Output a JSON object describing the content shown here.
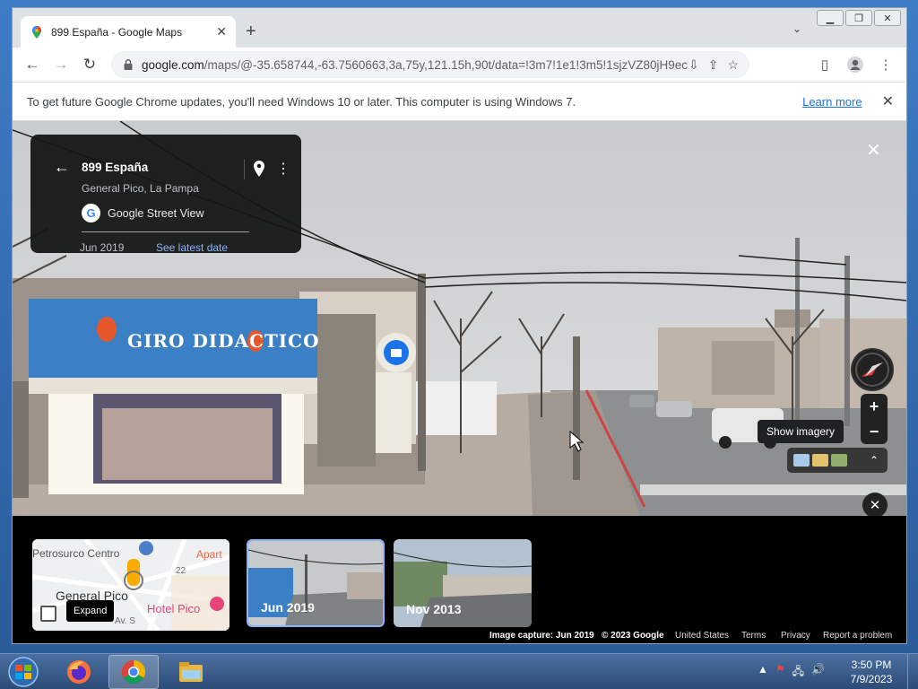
{
  "browser": {
    "tab_title": "899 España - Google Maps",
    "url_host": "google.com",
    "url_rest": "/maps/@-35.658744,-63.7560663,3a,75y,121.15h,90t/data=!3m7!1e1!3m5!1sjzVZ80jH9ecl..."
  },
  "infobar": {
    "message": "To get future Google Chrome updates, you'll need Windows 10 or later. This computer is using Windows 7.",
    "link": "Learn more"
  },
  "panel": {
    "title": "899 España",
    "subtitle": "General Pico, La Pampa",
    "source": "Google Street View",
    "date": "Jun 2019",
    "latest_link": "See latest date"
  },
  "scene": {
    "shop_sign": "GIRO DIDACTICO"
  },
  "controls": {
    "zoom_in": "+",
    "zoom_out": "−",
    "tooltip": "Show imagery"
  },
  "filmstrip": {
    "map_labels": [
      "Petrosurco Centro",
      "Apart",
      "General Pico",
      "Hotel Pico",
      "22",
      "Av. S"
    ],
    "expand_tip": "Expand",
    "thumbs": [
      {
        "label": "Jun 2019"
      },
      {
        "label": "Nov 2013"
      }
    ]
  },
  "attribution": {
    "capture": "Image capture: Jun 2019",
    "copyright": "© 2023 Google",
    "country": "United States",
    "terms": "Terms",
    "privacy": "Privacy",
    "report": "Report a problem"
  },
  "taskbar": {
    "time": "3:50 PM",
    "date": "7/9/2023"
  },
  "colors": {
    "accent": "#1a73e8",
    "link_on_dark": "#8ab4f8",
    "selected_thumb_border": "#8ab4f8"
  }
}
